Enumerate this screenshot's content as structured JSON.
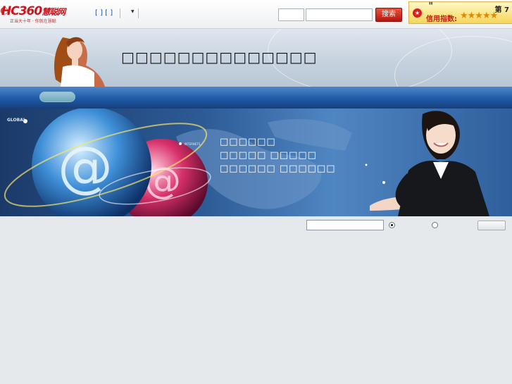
{
  "site": {
    "logo_text": "HC360",
    "logo_sub": "慧聪网",
    "logo_tagline": "正当大十年 · 你就在慧聪"
  },
  "topbar": {
    "login_links": "[ ] [ ]",
    "search_button": "搜索"
  },
  "credit": {
    "rank_label": "第 7",
    "index_label": "信用指数:",
    "stars": "★★★★★",
    "rating": 5
  },
  "header": {
    "company_name": "□□□□□□□□□□□□□□"
  },
  "banner": {
    "global_label": "GLOBAL",
    "lines": [
      "□□□□□□",
      "□□□□□ □□□□□",
      "□□□□□□ □□□□□□"
    ]
  },
  "colors": {
    "brand_red": "#d0121b",
    "nav_blue": "#1f5aa8",
    "background": "#e6e9ec"
  }
}
